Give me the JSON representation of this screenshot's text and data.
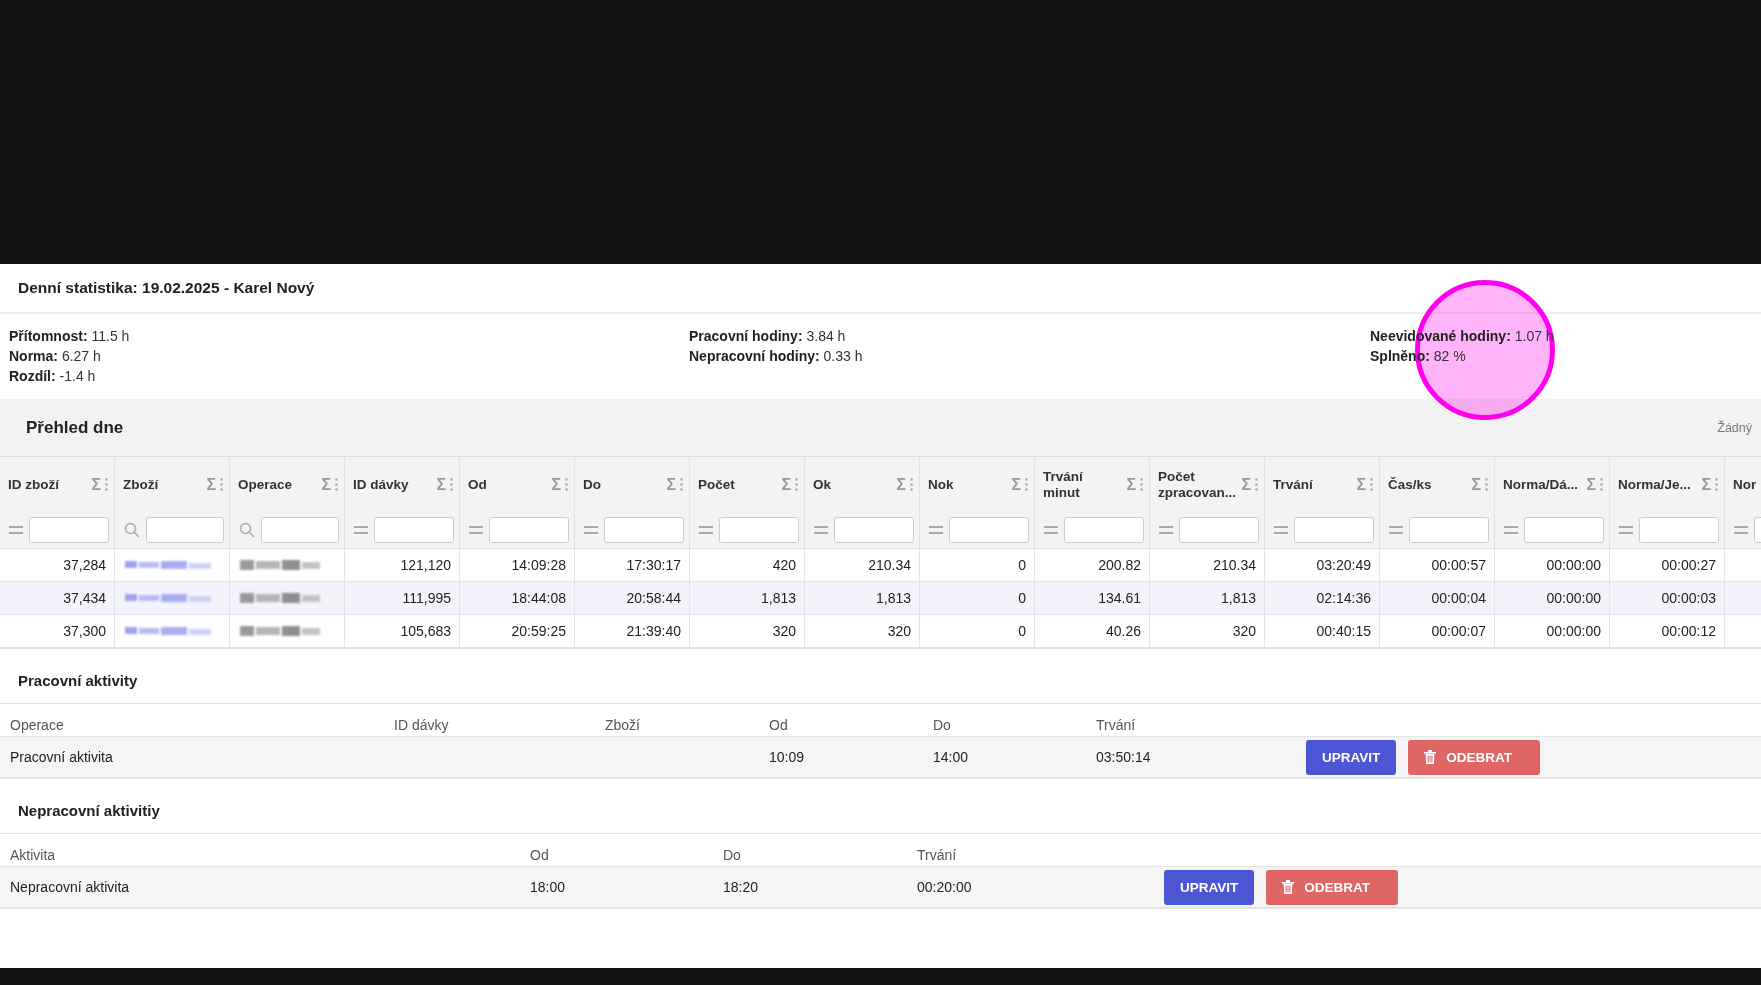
{
  "header": {
    "title": "Denní statistika: 19.02.2025 - Karel Nový"
  },
  "stats": [
    [
      "**Přítomnost:** 11.5 h",
      "**Norma:** 6.27 h",
      "**Rozdíl:** -1.4 h"
    ],
    [
      "**Pracovní hodiny:** 3.84 h",
      "**Nepracovní hodiny:** 0.33 h"
    ],
    [
      "**Neevidované hodiny:** 1.07 h",
      "**Splněno:** 82 %"
    ]
  ],
  "overview": {
    "title": "Přehled dne",
    "grouping": "Žádný",
    "columns": [
      {
        "label": "ID zboží",
        "kind": "equals",
        "sum": "Σ"
      },
      {
        "label": "Zboží",
        "kind": "search",
        "sum": "Σ"
      },
      {
        "label": "Operace",
        "kind": "search",
        "sum": "Σ"
      },
      {
        "label": "ID dávky",
        "kind": "equals",
        "sum": "Σ"
      },
      {
        "label": "Od",
        "kind": "equals",
        "sum": "Σ"
      },
      {
        "label": "Do",
        "kind": "equals",
        "sum": "Σ"
      },
      {
        "label": "Počet",
        "kind": "equals",
        "sum": "Σ"
      },
      {
        "label": "Ok",
        "kind": "equals",
        "sum": "Σ"
      },
      {
        "label": "Nok",
        "kind": "equals",
        "sum": "Σ"
      },
      {
        "label": "Trvání minut",
        "kind": "equals",
        "sum": "Σ"
      },
      {
        "label": "Počet zpracovan...",
        "kind": "equals",
        "sum": "Σ"
      },
      {
        "label": "Trvání",
        "kind": "equals",
        "sum": "Σ"
      },
      {
        "label": "Čas/ks",
        "kind": "equals",
        "sum": "Σ"
      },
      {
        "label": "Norma/Dá...",
        "kind": "equals",
        "sum": "Σ"
      },
      {
        "label": "Norma/Je...",
        "kind": "equals",
        "sum": "Σ"
      },
      {
        "label": "Nor",
        "kind": "equals"
      }
    ],
    "rows": [
      {
        "highlighted": false,
        "cells": [
          "37,284",
          {
            "kind": "blurred-link"
          },
          {
            "kind": "blurred"
          },
          "121,120",
          "14:09:28",
          "17:30:17",
          "420",
          "210.34",
          "0",
          "200.82",
          "210.34",
          "03:20:49",
          "00:00:57",
          "00:00:00",
          "00:00:27"
        ]
      },
      {
        "highlighted": true,
        "cells": [
          "37,434",
          {
            "kind": "blurred-link"
          },
          {
            "kind": "blurred"
          },
          "111,995",
          "18:44:08",
          "20:58:44",
          "1,813",
          "1,813",
          "0",
          "134.61",
          "1,813",
          "02:14:36",
          "00:00:04",
          "00:00:00",
          "00:00:03"
        ]
      },
      {
        "highlighted": false,
        "cells": [
          "37,300",
          {
            "kind": "blurred-link"
          },
          {
            "kind": "blurred"
          },
          "105,683",
          "20:59:25",
          "21:39:40",
          "320",
          "320",
          "0",
          "40.26",
          "320",
          "00:40:15",
          "00:00:07",
          "00:00:00",
          "00:00:12"
        ]
      }
    ]
  },
  "activities": [
    {
      "title": "Pracovní aktivity",
      "kind": "work",
      "columns": [
        "Operace",
        "ID dávky",
        "Zboží",
        "Od",
        "Do",
        "Trvání"
      ],
      "rows": [
        {
          "cells": [
            "Pracovní aktivita",
            null,
            null,
            "10:09",
            "14:00",
            "03:50:14"
          ],
          "actions": [
            {
              "kind": "edit",
              "label": "UPRAVIT"
            },
            {
              "kind": "remove",
              "label": "ODEBRAT"
            }
          ]
        }
      ]
    },
    {
      "title": "Nepracovní aktivitiy",
      "kind": "nonwork",
      "columns": [
        "Aktivita",
        "Od",
        "Do",
        "Trvání"
      ],
      "rows": [
        {
          "cells": [
            "Nepracovní aktivita",
            "18:00",
            "18:20",
            "00:20:00"
          ],
          "actions": [
            {
              "kind": "edit",
              "label": "UPRAVIT"
            },
            {
              "kind": "remove",
              "label": "ODEBRAT"
            }
          ]
        }
      ]
    }
  ]
}
